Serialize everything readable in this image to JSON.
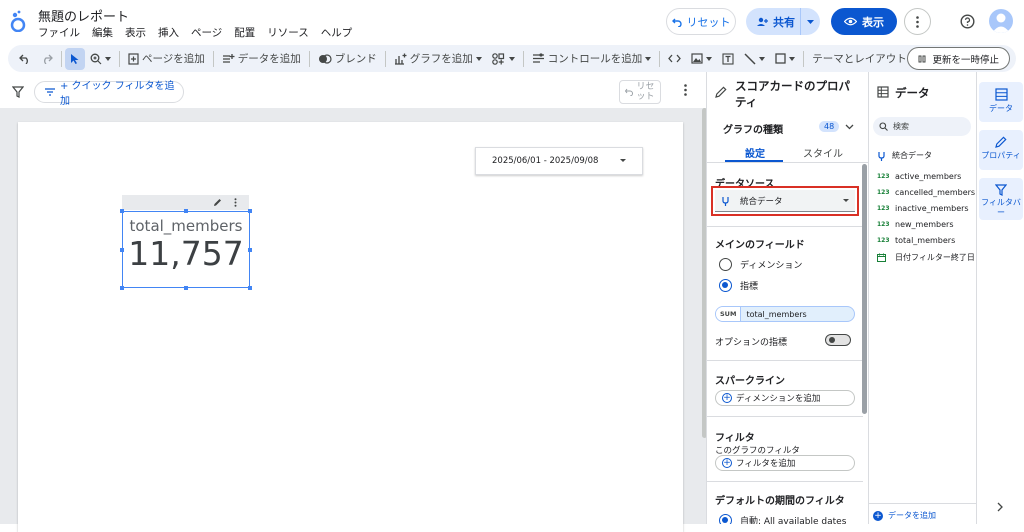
{
  "header": {
    "title": "無題のレポート",
    "menu": [
      "ファイル",
      "編集",
      "表示",
      "挿入",
      "ページ",
      "配置",
      "リソース",
      "ヘルプ"
    ],
    "reset_label": "リセット",
    "share_label": "共有",
    "view_label": "表示"
  },
  "toolbar": {
    "add_page": "ページを追加",
    "add_data": "データを追加",
    "blend": "ブレンド",
    "add_chart": "グラフを追加",
    "add_control": "コントロールを追加",
    "theme_layout": "テーマとレイアウト",
    "pause_update": "更新を一時停止"
  },
  "filter_bar": {
    "quick_filter": "+ クイック フィルタを追加",
    "reset_line1": "リセ",
    "reset_line2": "ット"
  },
  "canvas": {
    "date_range": "2025/06/01 - 2025/09/08",
    "scorecard": {
      "label": "total_members",
      "value": "11,757"
    }
  },
  "properties": {
    "title": "スコアカードのプロパティ",
    "chart_type_label": "グラフの種類",
    "chart_type_count": "48",
    "tabs": {
      "settings": "設定",
      "style": "スタイル"
    },
    "data_source": {
      "title": "データソース",
      "value": "統合データ"
    },
    "main_field": {
      "title": "メインのフィールド",
      "dimension": "ディメンション",
      "metric": "指標",
      "metric_agg": "SUM",
      "metric_name": "total_members",
      "optional_metric": "オプションの指標"
    },
    "sparkline": {
      "title": "スパークライン",
      "add_dimension": "ディメンションを追加"
    },
    "filter": {
      "title": "フィルタ",
      "sub": "このグラフのフィルタ",
      "add": "フィルタを追加"
    },
    "default_period": {
      "title": "デフォルトの期間のフィルタ",
      "option": "自動: All available dates"
    }
  },
  "data_panel": {
    "title": "データ",
    "search_placeholder": "検索",
    "source": "統合データ",
    "fields": [
      {
        "type": "123",
        "name": "active_members"
      },
      {
        "type": "123",
        "name": "cancelled_members"
      },
      {
        "type": "123",
        "name": "inactive_members"
      },
      {
        "type": "123",
        "name": "new_members"
      },
      {
        "type": "123",
        "name": "total_members"
      },
      {
        "type": "date",
        "name": "日付フィルター終了日"
      }
    ],
    "add_data": "データを追加"
  },
  "rail": {
    "data": "データ",
    "properties": "プロパティ",
    "filter_bar": "フィルタバー"
  },
  "colors": {
    "accent": "#0b57d0",
    "highlight": "#d93025",
    "toolbar_bg": "#eef2f9"
  }
}
